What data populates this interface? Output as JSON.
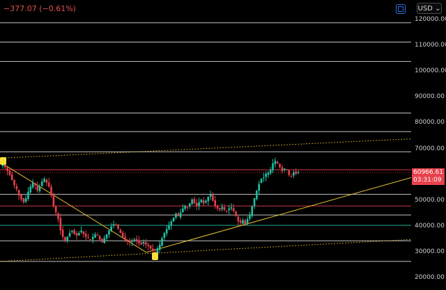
{
  "header": {
    "change_text": "−377.07 (−0.61%)",
    "currency": "USD",
    "currency_chevron": "⌄",
    "toolbar_icon": "box-icon"
  },
  "axis": {
    "ticks": [
      "120000.00",
      "110000.00",
      "100000.00",
      "90000.00",
      "80000.00",
      "70000.00",
      "60000.00",
      "50000.00",
      "40000.00",
      "30000.00",
      "20000.00"
    ]
  },
  "price": {
    "last": "60966.61",
    "countdown": "03:31:09"
  },
  "colors": {
    "background": "#000000",
    "up": "#1fc3a4",
    "down": "#e8404b",
    "trend": "#e8c42e",
    "accent": "#2f6fe8"
  },
  "chart_data": {
    "type": "candlestick",
    "ylim": [
      18000,
      125000
    ],
    "horizontal_levels": [
      {
        "price": 119000,
        "color": "#d8d8d8"
      },
      {
        "price": 111500,
        "color": "#d8d8d8"
      },
      {
        "price": 104000,
        "color": "#d8d8d8"
      },
      {
        "price": 84000,
        "color": "#d8d8d8"
      },
      {
        "price": 76800,
        "color": "#d8d8d8"
      },
      {
        "price": 69000,
        "color": "#d8d8d8"
      },
      {
        "price": 62000,
        "color": "#e8404b"
      },
      {
        "price": 52500,
        "color": "#d8d8d8"
      },
      {
        "price": 48000,
        "color": "#e8404b"
      },
      {
        "price": 44500,
        "color": "#d8d8d8"
      },
      {
        "price": 40500,
        "color": "#1fc3a4"
      },
      {
        "price": 34500,
        "color": "#d8d8d8"
      },
      {
        "price": 26500,
        "color": "#d8d8d8"
      }
    ],
    "close_path": [
      64000,
      63000,
      61500,
      60000,
      58000,
      56000,
      54500,
      52000,
      50500,
      49500,
      51000,
      53500,
      55500,
      57000,
      56000,
      54000,
      55500,
      57500,
      58500,
      57000,
      55500,
      52000,
      48000,
      45500,
      43000,
      38500,
      36000,
      34500,
      36000,
      37500,
      38500,
      37000,
      36500,
      37500,
      38500,
      37000,
      36000,
      35500,
      35000,
      36000,
      37000,
      36500,
      35000,
      34000,
      35500,
      37000,
      38500,
      40000,
      41000,
      40500,
      39000,
      37500,
      36000,
      35000,
      34500,
      34000,
      34500,
      35000,
      34500,
      33500,
      33000,
      34000,
      33000,
      32500,
      31500,
      30500,
      30000,
      31500,
      33000,
      35500,
      37500,
      39000,
      40500,
      42000,
      43500,
      45000,
      44000,
      45500,
      47000,
      48000,
      47500,
      49000,
      50500,
      49000,
      48000,
      49500,
      50500,
      49000,
      50000,
      51500,
      52500,
      50000,
      48000,
      47000,
      46500,
      47500,
      46500,
      46000,
      47000,
      47500,
      46000,
      44000,
      42000,
      41500,
      42500,
      41000,
      43000,
      44500,
      48000,
      51000,
      54000,
      56500,
      58500,
      59000,
      60500,
      61000,
      62000,
      64500,
      65500,
      64500,
      63000,
      61500,
      62500,
      62000,
      60000,
      59500,
      61000,
      60500,
      60966.61
    ],
    "trend_lines": [
      {
        "from_price": 66500,
        "to_price": 74000,
        "style": "dotted"
      },
      {
        "from_price": 26500,
        "to_price": 35000,
        "style": "dotted"
      },
      {
        "from_price": 65000,
        "to_price": 30000,
        "style": "solid"
      },
      {
        "from_price": 30000,
        "to_price": 59000,
        "style": "solid"
      }
    ],
    "markers": [
      {
        "price": 65500,
        "index": 0
      },
      {
        "price": 28500,
        "index": 66
      }
    ]
  }
}
